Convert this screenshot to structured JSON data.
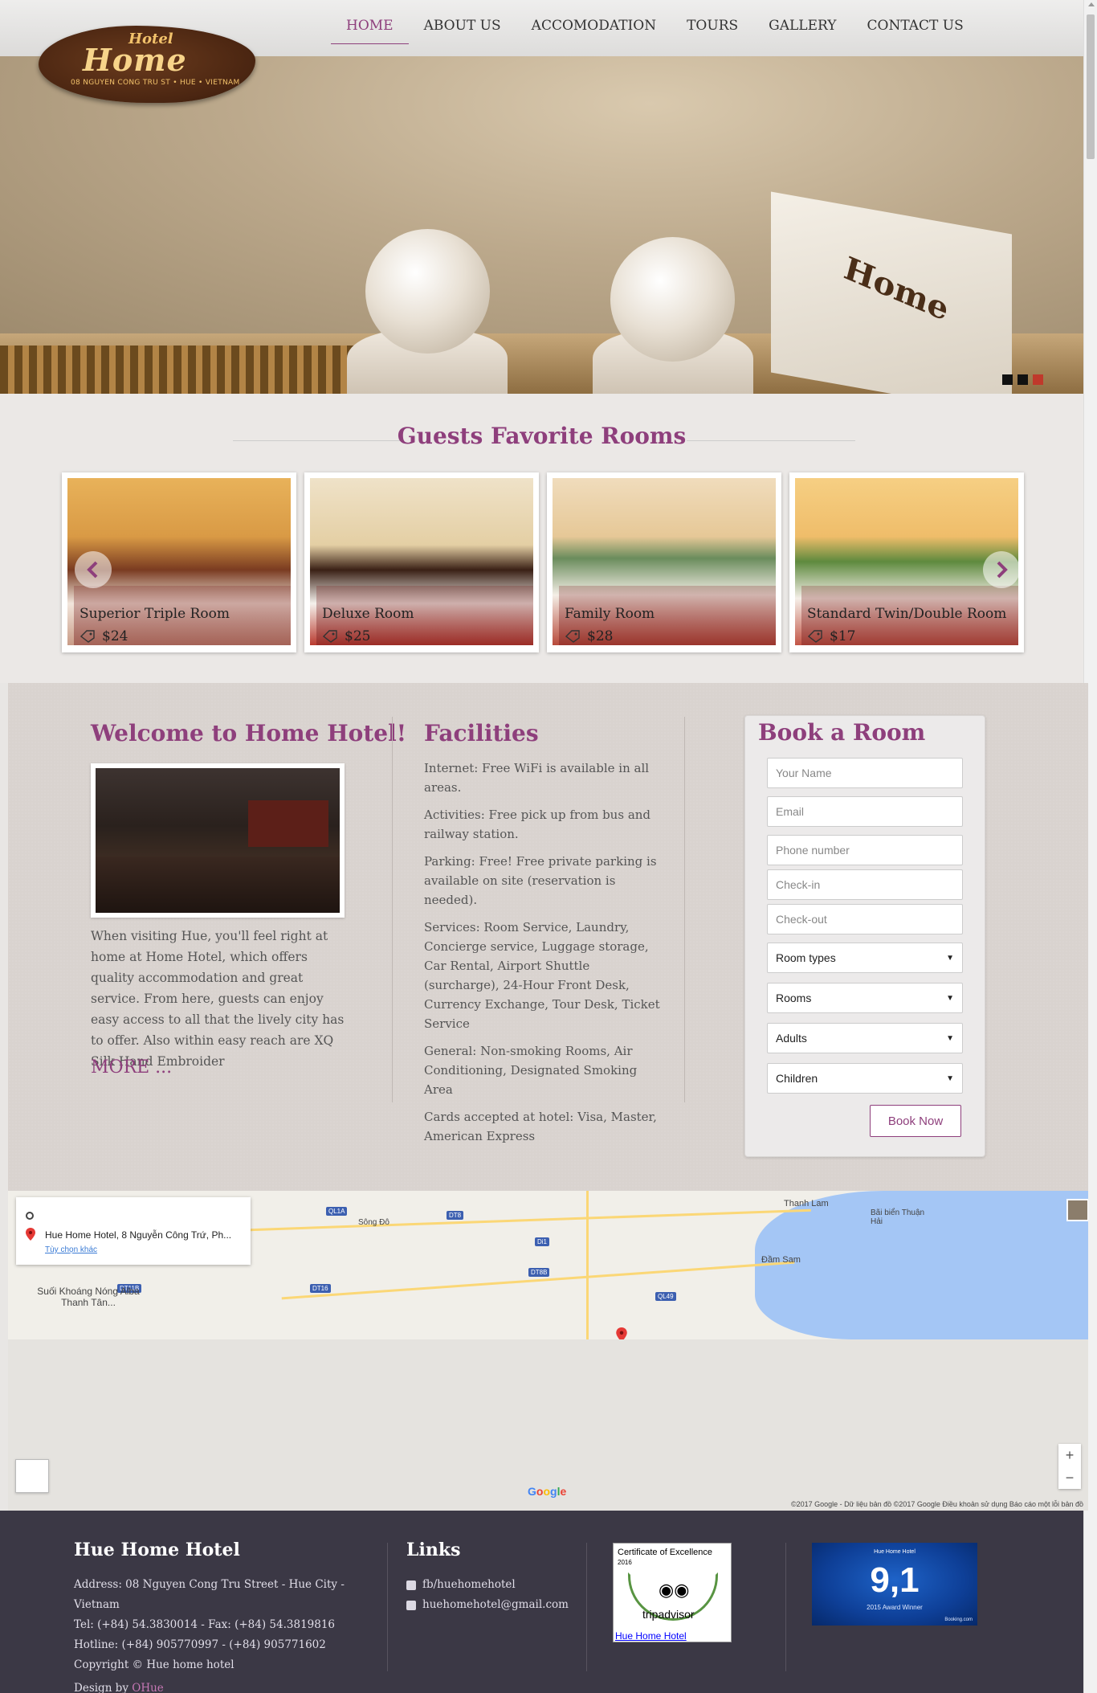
{
  "logo": {
    "top": "Hotel",
    "main": "Home",
    "sub": "08 NGUYEN CONG TRU ST • HUE • VIETNAM"
  },
  "nav": [
    {
      "label": "HOME",
      "active": true
    },
    {
      "label": "ABOUT US"
    },
    {
      "label": "ACCOMODATION"
    },
    {
      "label": "TOURS"
    },
    {
      "label": "GALLERY"
    },
    {
      "label": "CONTACT US"
    }
  ],
  "hero": {
    "box_text": "Home",
    "slides": 3,
    "active_slide": 3
  },
  "rooms": {
    "title": "Guests Favorite Rooms",
    "items": [
      {
        "name": "Superior Triple Room",
        "price": "$24"
      },
      {
        "name": "Deluxe Room",
        "price": "$25"
      },
      {
        "name": "Family Room",
        "price": "$28"
      },
      {
        "name": "Standard Twin/Double Room",
        "price": "$17"
      }
    ]
  },
  "welcome": {
    "title": "Welcome to Home Hotel!",
    "text": "When visiting Hue, you'll feel right at home at Home Hotel, which offers quality accommodation and great service. From here, guests can enjoy easy access to all that the lively city has to offer. Also within easy reach are XQ Silk Hand Embroider",
    "more": "MORE ..."
  },
  "facilities": {
    "title": "Facilities",
    "items": [
      "Internet: Free WiFi is available in all areas.",
      "Activities: Free pick up from bus and railway station.",
      "Parking: Free! Free private parking is available on site (reservation is needed).",
      "Services: Room Service, Laundry, Concierge service, Luggage storage, Car Rental, Airport Shuttle (surcharge), 24-Hour Front Desk, Currency Exchange, Tour Desk, Ticket Service",
      "General: Non-smoking Rooms, Air Conditioning, Designated Smoking Area",
      "Cards accepted at hotel: Visa, Master, American Express"
    ]
  },
  "booking": {
    "title": "Book a Room",
    "name_placeholder": "Your Name",
    "email_placeholder": "Email",
    "phone_placeholder": "Phone number",
    "checkin_placeholder": "Check-in",
    "checkout_placeholder": "Check-out",
    "room_types": "Room types",
    "rooms": "Rooms",
    "adults": "Adults",
    "children": "Children",
    "button": "Book Now"
  },
  "map": {
    "address": "Hue Home Hotel, 8 Nguyễn Công Trứ, Ph...",
    "options": "Tùy chọn khác",
    "place_label": "Suối Khoáng Nóng Alba Thanh Tân...",
    "beach_label": "Bãi biển Thuận Hải",
    "lagoon_label": "Đầm Sam",
    "lam_label": "Thanh Lam",
    "song_label": "Sông Đô",
    "road_labels": [
      "QL1A",
      "DT8",
      "DT8B",
      "QL49",
      "DT16",
      "DT11B",
      "Di1"
    ],
    "google": "Google",
    "terms": "©2017 Google - Dữ liệu bản đồ ©2017 Google   Điều khoản sử dụng   Báo cáo một lỗi bản đồ",
    "zoom_in": "+",
    "zoom_out": "−"
  },
  "footer": {
    "hotel_title": "Hue Home Hotel",
    "address": "Address: 08 Nguyen Cong Tru Street - Hue City - Vietnam",
    "tel": "Tel: (+84) 54.3830014 - Fax: (+84) 54.3819816",
    "hotline": "Hotline: (+84) 905770997 - (+84) 905771602",
    "copyright": "Copyright © Hue home hotel",
    "design_prefix": "Design by ",
    "design_link": "OHue",
    "links_title": "Links",
    "facebook": "fb/huehomehotel",
    "email": "huehomehotel@gmail.com",
    "ta_title": "Certificate of Excellence",
    "ta_year": "2016",
    "ta_brand": "tripadvisor",
    "ta_link": "Hue Home Hotel",
    "bk_head": "Hue Home Hotel",
    "bk_score": "9,1",
    "bk_award": "2015 Award Winner",
    "bk_brand": "Booking.com"
  }
}
